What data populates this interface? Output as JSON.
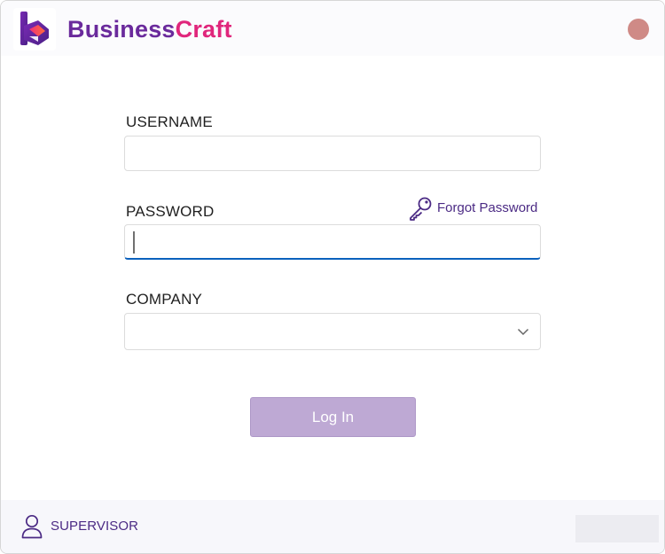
{
  "app": {
    "brand_part1": "Business",
    "brand_part2": "Craft",
    "colors": {
      "brand_purple": "#6a2a9c",
      "brand_pink": "#e0267c",
      "accent_blue": "#0b61bd",
      "button_disabled": "#bea9d4",
      "close_dot": "#cf8a86"
    }
  },
  "titlebar": {
    "logo_icon": "businesscraft-logo-icon",
    "close_icon": "close-dot-icon"
  },
  "form": {
    "username": {
      "label": "USERNAME",
      "value": "",
      "placeholder": ""
    },
    "password": {
      "label": "PASSWORD",
      "value": "",
      "placeholder": ""
    },
    "forgot_password": {
      "label": "Forgot Password",
      "icon": "key-icon"
    },
    "company": {
      "label": "COMPANY",
      "selected": "",
      "icon": "chevron-down-icon"
    },
    "login_label": "Log In"
  },
  "footer": {
    "user_icon": "user-icon",
    "user_name": "SUPERVISOR"
  }
}
